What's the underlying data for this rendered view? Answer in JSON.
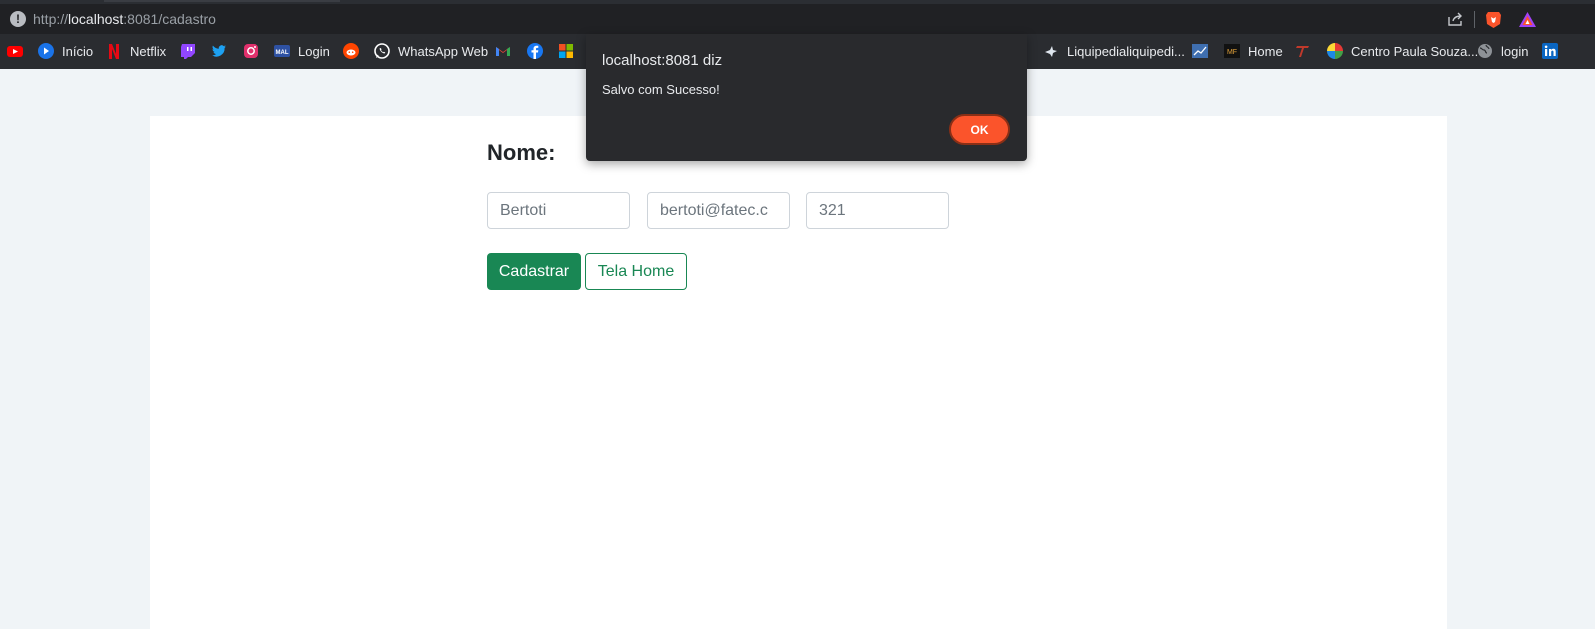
{
  "browser": {
    "url_scheme": "http://",
    "url_host": "localhost",
    "url_rest": ":8081/cadastro",
    "bookmarks": [
      {
        "label": "",
        "icon": "youtube-icon"
      },
      {
        "label": "Início",
        "icon": "play-icon"
      },
      {
        "label": "Netflix",
        "icon": "netflix-icon"
      },
      {
        "label": "",
        "icon": "twitch-icon"
      },
      {
        "label": "",
        "icon": "twitter-icon"
      },
      {
        "label": "",
        "icon": "instagram-icon"
      },
      {
        "label": "Login",
        "icon": "mal-icon"
      },
      {
        "label": "",
        "icon": "reddit-icon"
      },
      {
        "label": "WhatsApp Web",
        "icon": "whatsapp-icon"
      },
      {
        "label": "",
        "icon": "gmail-icon"
      },
      {
        "label": "",
        "icon": "facebook-icon"
      },
      {
        "label": "",
        "icon": "microsoft-icon"
      },
      {
        "label": "Liquipedialiquipedi...",
        "icon": "liquipedia-icon"
      },
      {
        "label": "",
        "icon": "chart-bookmark-icon"
      },
      {
        "label": "Home",
        "icon": "mf-icon"
      },
      {
        "label": "",
        "icon": "t-logo-icon"
      },
      {
        "label": "Centro Paula Souza...",
        "icon": "cps-icon"
      },
      {
        "label": "login",
        "icon": "globe-icon"
      },
      {
        "label": "",
        "icon": "linkedin-icon"
      }
    ]
  },
  "form": {
    "title": "Nome:",
    "name_value": "Bertoti",
    "email_value": "bertoti@fatec.c",
    "number_value": "321",
    "submit_label": "Cadastrar",
    "home_label": "Tela Home"
  },
  "dialog": {
    "title": "localhost:8081 diz",
    "message": "Salvo com Sucesso!",
    "ok_label": "OK"
  },
  "colors": {
    "accent_green": "#198754",
    "dialog_button": "#fb542b"
  }
}
